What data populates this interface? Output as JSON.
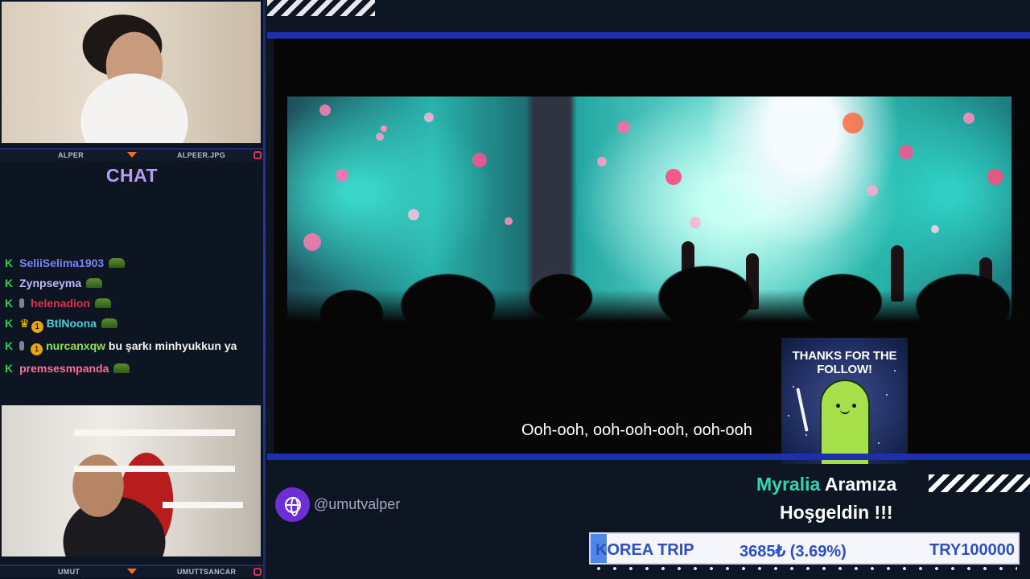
{
  "webcam_top": {
    "name_left": "ALPER",
    "name_right": "ALPEER.JPG"
  },
  "webcam_bottom": {
    "name_left": "UMUT",
    "name_right": "UMUTTSANCAR"
  },
  "chat": {
    "title": "CHAT",
    "messages": [
      {
        "user": "SeliiSelima1903",
        "color": "#7a83ff",
        "text": "",
        "badges": [],
        "emote": true
      },
      {
        "user": "Zynpseyma",
        "color": "#c2b8ff",
        "text": "",
        "badges": [],
        "emote": true
      },
      {
        "user": "helenadion",
        "color": "#e0304e",
        "text": "",
        "badges": [
          "mic"
        ],
        "emote": true
      },
      {
        "user": "BtlNoona",
        "color": "#48cfd8",
        "text": "",
        "badges": [
          "crown",
          "1"
        ],
        "emote": true
      },
      {
        "user": "nurcanxqw",
        "color": "#92e24b",
        "text": "bu şarkı minhyukkun ya",
        "badges": [
          "mic",
          "1"
        ],
        "emote": false
      },
      {
        "user": "premsesmpanda",
        "color": "#ff6a9e",
        "text": "",
        "badges": [],
        "emote": true
      }
    ],
    "mod_icon": "K"
  },
  "video": {
    "subtitle": "Ooh-ooh, ooh-ooh-ooh, ooh-ooh"
  },
  "follow_alert": {
    "card_text": "THANKS FOR THE FOLLOW!",
    "username": "Myralia",
    "line1_rest": "Aramıza",
    "line2": "Hoşgeldin !!!"
  },
  "social": {
    "handle": "@umutvalper",
    "icon": "globe-icon"
  },
  "goal": {
    "title": "KOREA TRIP",
    "progress_text": "3685₺ (3.69%)",
    "target": "TRY100000",
    "progress_fraction": 0.0369
  },
  "colors": {
    "accent_blue": "#1e2eb0",
    "chat_title": "#b79cf0",
    "alert_user": "#2fd7b0",
    "goal_text": "#2c50c4"
  }
}
